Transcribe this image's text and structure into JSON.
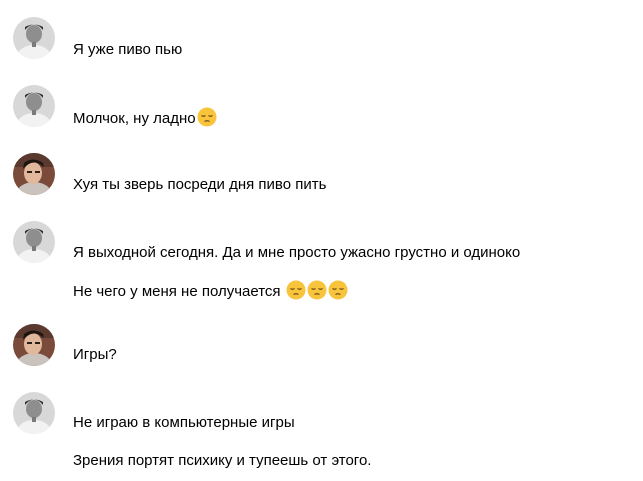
{
  "conversation": {
    "messages": [
      {
        "author": "user_a",
        "text": "Я уже пиво пью",
        "emoji_count": 0
      },
      {
        "author": "user_a",
        "text": "Молчок, ну ладно",
        "emoji_count": 1
      },
      {
        "author": "user_b",
        "text": "Хуя ты зверь посреди дня пиво пить",
        "emoji_count": 0
      },
      {
        "author": "user_a",
        "text": "Я выходной сегодня. Да и мне просто ужасно грустно и одиноко",
        "emoji_count": 0
      },
      {
        "author": "user_a",
        "text": "Не чего у меня не получается ",
        "emoji_count": 3
      },
      {
        "author": "user_b",
        "text": "Игры?",
        "emoji_count": 0
      },
      {
        "author": "user_a",
        "text": "Не играю в компьютерные игры",
        "emoji_count": 0
      },
      {
        "author": "user_a",
        "text": "Зрения портят психику и тупеешь от этого.",
        "emoji_count": 0
      }
    ]
  },
  "icons": {
    "avatar_a": "avatar-photo-grayscale-man",
    "avatar_b": "avatar-photo-color-man",
    "emoji": "pensive-face-emoji"
  },
  "colors": {
    "background": "#ffffff",
    "text": "#000000",
    "emoji_face": "#f7c43b"
  }
}
